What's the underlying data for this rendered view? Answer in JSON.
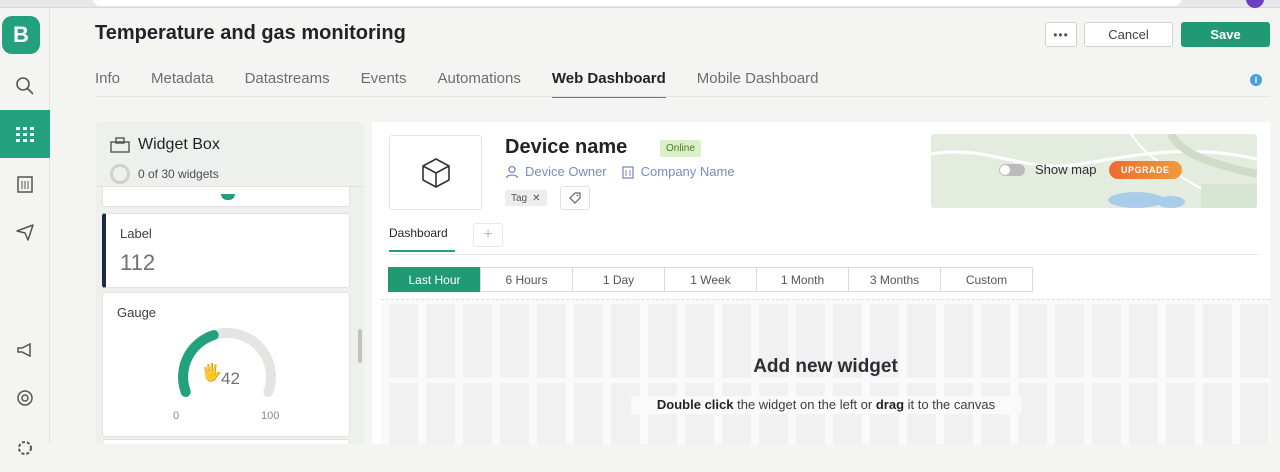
{
  "header": {
    "title": "Temperature and gas monitoring",
    "more_label": "•••",
    "cancel_label": "Cancel",
    "save_label": "Save",
    "tabs": [
      {
        "label": "Info",
        "active": false
      },
      {
        "label": "Metadata",
        "active": false
      },
      {
        "label": "Datastreams",
        "active": false
      },
      {
        "label": "Events",
        "active": false
      },
      {
        "label": "Automations",
        "active": false
      },
      {
        "label": "Web Dashboard",
        "active": true
      },
      {
        "label": "Mobile Dashboard",
        "active": false
      }
    ],
    "info_icon": "i"
  },
  "sidebar": {
    "logo": "B",
    "items": [
      {
        "icon": "search-icon"
      },
      {
        "icon": "grid-icon",
        "active": true
      },
      {
        "icon": "building-icon"
      },
      {
        "icon": "send-icon"
      },
      {
        "icon": "megaphone-icon"
      },
      {
        "icon": "lifebuoy-icon"
      },
      {
        "icon": "settings-icon"
      }
    ]
  },
  "widget_box": {
    "title": "Widget Box",
    "count_text": "0 of 30 widgets",
    "label_widget": {
      "title": "Label",
      "value": "112"
    },
    "gauge_widget": {
      "title": "Gauge",
      "value": "42",
      "min": "0",
      "max": "100",
      "fraction": 0.42
    }
  },
  "device": {
    "name": "Device name",
    "status": "Online",
    "owner": "Device Owner",
    "company": "Company Name",
    "tag": "Tag",
    "show_map_label": "Show map",
    "upgrade_label": "UPGRADE"
  },
  "dashboard": {
    "tab_label": "Dashboard",
    "add_label": "+",
    "time_ranges": [
      {
        "label": "Last Hour",
        "active": true
      },
      {
        "label": "6 Hours",
        "active": false
      },
      {
        "label": "1 Day",
        "active": false
      },
      {
        "label": "1 Week",
        "active": false
      },
      {
        "label": "1 Month",
        "active": false
      },
      {
        "label": "3 Months",
        "active": false
      },
      {
        "label": "Custom",
        "active": false
      }
    ],
    "empty_title": "Add new widget",
    "empty_bold_1": "Double click",
    "empty_text_1": " the widget on the left or ",
    "empty_bold_2": "drag",
    "empty_text_2": " it to the canvas"
  },
  "colors": {
    "accent": "#23a07d",
    "save": "#1f9a73",
    "online_bg": "#d9efc6",
    "upgrade": "#f06a34"
  }
}
